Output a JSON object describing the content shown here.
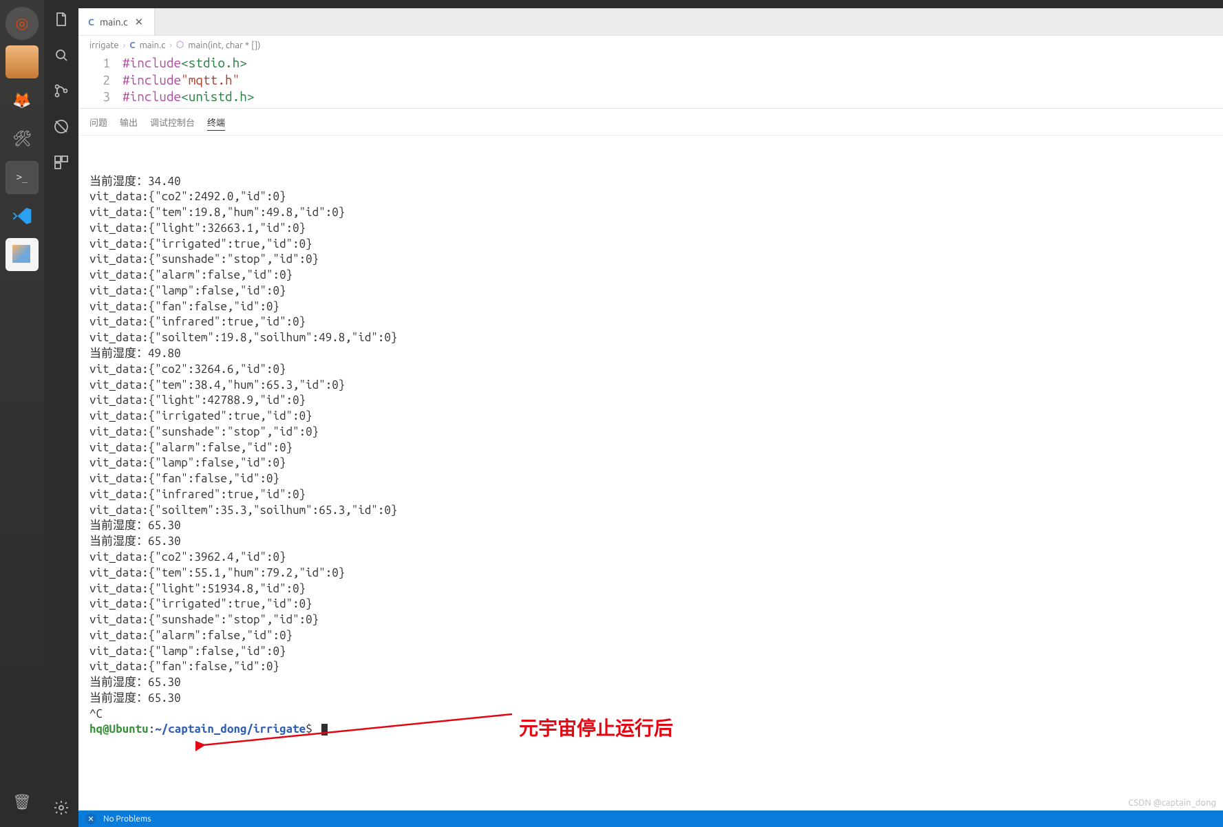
{
  "launcher": {
    "items": [
      {
        "name": "ubuntu",
        "glyph": "◎"
      },
      {
        "name": "files",
        "glyph": ""
      },
      {
        "name": "firefox",
        "glyph": "🦊"
      },
      {
        "name": "settings",
        "glyph": "🛠"
      },
      {
        "name": "terminal",
        "glyph": ">_"
      },
      {
        "name": "vscode",
        "glyph": ""
      },
      {
        "name": "gedit",
        "glyph": ""
      }
    ],
    "trash": "🗑"
  },
  "tab": {
    "lang": "C",
    "filename": "main.c"
  },
  "breadcrumbs": {
    "folder": "irrigate",
    "lang": "C",
    "file": "main.c",
    "symbol": "main(int, char * [])"
  },
  "code": [
    {
      "n": "1",
      "include": "#include",
      "open": "<",
      "header": "stdio.h",
      "close": ">",
      "sys": true
    },
    {
      "n": "2",
      "include": "#include",
      "open": "\"",
      "header": "mqtt.h",
      "close": "\"",
      "sys": false
    },
    {
      "n": "3",
      "include": "#include",
      "open": "<",
      "header": "unistd.h",
      "close": ">",
      "sys": true
    }
  ],
  "panel_tabs": {
    "problems": "问题",
    "output": "输出",
    "debug": "调试控制台",
    "terminal": "终端"
  },
  "terminal_lines": [
    "当前湿度：34.40",
    "vit_data:{\"co2\":2492.0,\"id\":0}",
    "vit_data:{\"tem\":19.8,\"hum\":49.8,\"id\":0}",
    "vit_data:{\"light\":32663.1,\"id\":0}",
    "vit_data:{\"irrigated\":true,\"id\":0}",
    "vit_data:{\"sunshade\":\"stop\",\"id\":0}",
    "vit_data:{\"alarm\":false,\"id\":0}",
    "vit_data:{\"lamp\":false,\"id\":0}",
    "vit_data:{\"fan\":false,\"id\":0}",
    "vit_data:{\"infrared\":true,\"id\":0}",
    "vit_data:{\"soiltem\":19.8,\"soilhum\":49.8,\"id\":0}",
    "当前湿度：49.80",
    "vit_data:{\"co2\":3264.6,\"id\":0}",
    "vit_data:{\"tem\":38.4,\"hum\":65.3,\"id\":0}",
    "vit_data:{\"light\":42788.9,\"id\":0}",
    "vit_data:{\"irrigated\":true,\"id\":0}",
    "vit_data:{\"sunshade\":\"stop\",\"id\":0}",
    "vit_data:{\"alarm\":false,\"id\":0}",
    "vit_data:{\"lamp\":false,\"id\":0}",
    "vit_data:{\"fan\":false,\"id\":0}",
    "vit_data:{\"infrared\":true,\"id\":0}",
    "vit_data:{\"soiltem\":35.3,\"soilhum\":65.3,\"id\":0}",
    "当前湿度：65.30",
    "当前湿度：65.30",
    "vit_data:{\"co2\":3962.4,\"id\":0}",
    "vit_data:{\"tem\":55.1,\"hum\":79.2,\"id\":0}",
    "vit_data:{\"light\":51934.8,\"id\":0}",
    "vit_data:{\"irrigated\":true,\"id\":0}",
    "vit_data:{\"sunshade\":\"stop\",\"id\":0}",
    "vit_data:{\"alarm\":false,\"id\":0}",
    "vit_data:{\"lamp\":false,\"id\":0}",
    "vit_data:{\"fan\":false,\"id\":0}",
    "当前湿度：65.30",
    "当前湿度：65.30",
    "^C"
  ],
  "prompt": {
    "user": "hq@Ubuntu",
    "sep1": ":",
    "path": "~/captain_dong/irrigate",
    "sep2": "$"
  },
  "annotation_text": "元宇宙停止运行后",
  "status": {
    "no_problems": "No Problems"
  },
  "watermark": "CSDN @captain_dong"
}
